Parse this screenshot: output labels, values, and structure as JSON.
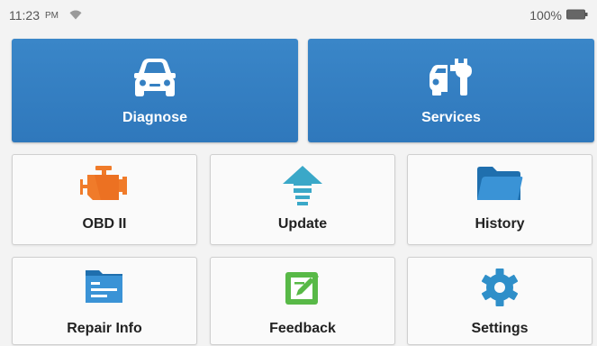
{
  "status_bar": {
    "time": "11:23",
    "ampm": "PM",
    "battery": "100%"
  },
  "tiles": {
    "diagnose": {
      "label": "Diagnose",
      "icon": "car-front-icon"
    },
    "services": {
      "label": "Services",
      "icon": "car-wrench-icon"
    },
    "obd": {
      "label": "OBD II",
      "icon": "engine-icon"
    },
    "update": {
      "label": "Update",
      "icon": "arrow-up-icon"
    },
    "history": {
      "label": "History",
      "icon": "folder-icon"
    },
    "repair_info": {
      "label": "Repair Info",
      "icon": "document-folder-icon"
    },
    "feedback": {
      "label": "Feedback",
      "icon": "edit-note-icon"
    },
    "settings": {
      "label": "Settings",
      "icon": "gear-icon"
    }
  },
  "colors": {
    "primary_blue": "#3a86c8",
    "engine_orange": "#f07b2a",
    "update_teal": "#3aa8c8",
    "feedback_green": "#58b947"
  }
}
